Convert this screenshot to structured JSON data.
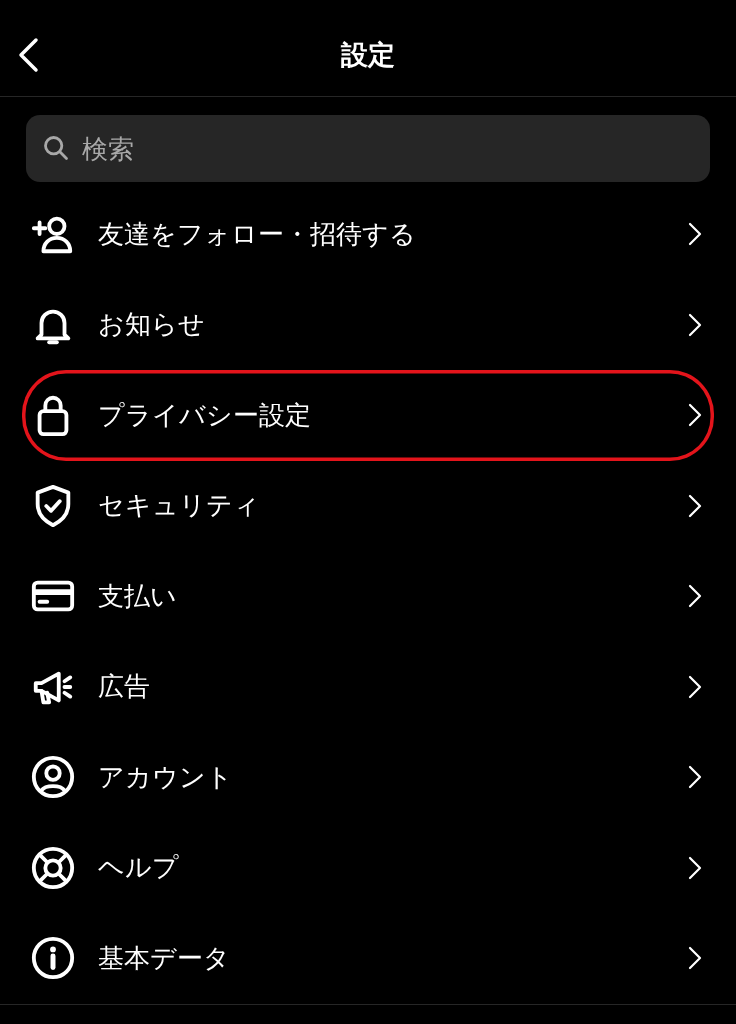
{
  "header": {
    "title": "設定"
  },
  "search": {
    "placeholder": "検索"
  },
  "items": [
    {
      "label": "友達をフォロー・招待する",
      "highlighted": false
    },
    {
      "label": "お知らせ",
      "highlighted": false
    },
    {
      "label": "プライバシー設定",
      "highlighted": true
    },
    {
      "label": "セキュリティ",
      "highlighted": false
    },
    {
      "label": "支払い",
      "highlighted": false
    },
    {
      "label": "広告",
      "highlighted": false
    },
    {
      "label": "アカウント",
      "highlighted": false
    },
    {
      "label": "ヘルプ",
      "highlighted": false
    },
    {
      "label": "基本データ",
      "highlighted": false
    }
  ]
}
